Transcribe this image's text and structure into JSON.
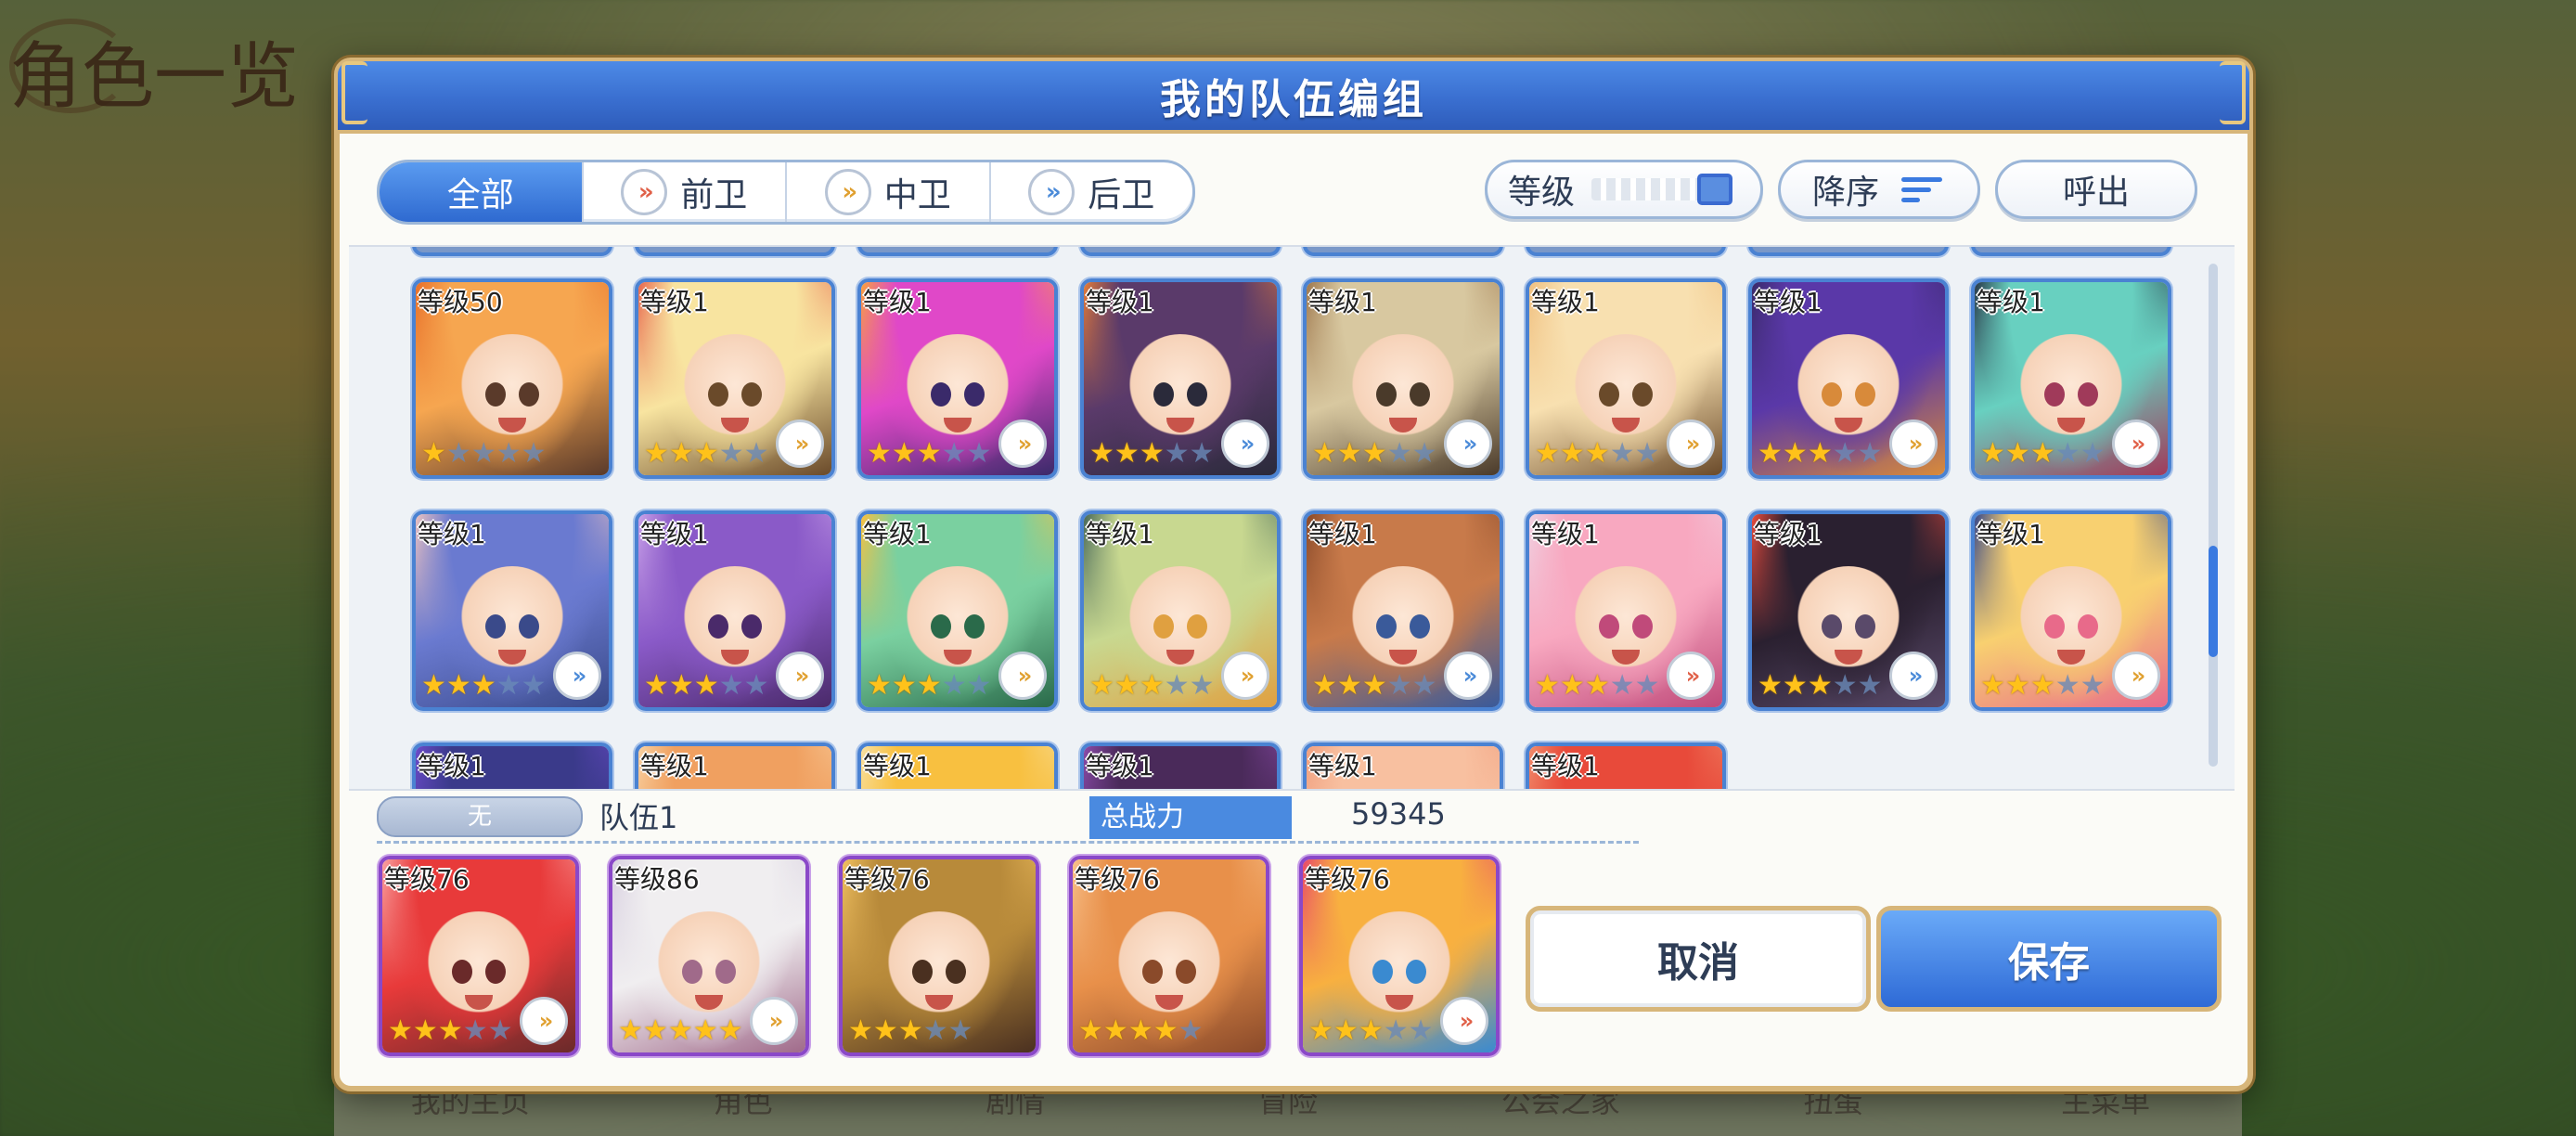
{
  "background": {
    "title": "角色一览",
    "nav": [
      "我的主页",
      "角色",
      "剧情",
      "冒险",
      "公会之家",
      "扭蛋",
      "主菜单"
    ]
  },
  "dialog": {
    "title": "我的队伍编组",
    "tabs": [
      {
        "label": "全部",
        "icon": "",
        "active": true
      },
      {
        "label": "前卫",
        "icon": "front-position-icon",
        "active": false
      },
      {
        "label": "中卫",
        "icon": "mid-position-icon",
        "active": false
      },
      {
        "label": "后卫",
        "icon": "back-position-icon",
        "active": false
      }
    ],
    "sort_label": "等级",
    "order_label": "降序",
    "call_label": "呼出",
    "scroll_position": 0.72
  },
  "characters": [
    {
      "level": "等级50",
      "stars": 1,
      "max": 5,
      "position": "",
      "colors": [
        "#f6a650",
        "#e8702a",
        "#5a3a2a"
      ]
    },
    {
      "level": "等级1",
      "stars": 3,
      "max": 5,
      "position": "mid",
      "colors": [
        "#f8e4a0",
        "#e86a50",
        "#6a4a2a"
      ]
    },
    {
      "level": "等级1",
      "stars": 3,
      "max": 5,
      "position": "mid",
      "colors": [
        "#e048c8",
        "#f8a040",
        "#3a2a6a"
      ]
    },
    {
      "level": "等级1",
      "stars": 3,
      "max": 5,
      "position": "back",
      "colors": [
        "#5a3a6a",
        "#e07a3a",
        "#2a2a3a"
      ]
    },
    {
      "level": "等级1",
      "stars": 3,
      "max": 5,
      "position": "back",
      "colors": [
        "#d8c8a0",
        "#a07a50",
        "#4a3a2a"
      ]
    },
    {
      "level": "等级1",
      "stars": 3,
      "max": 5,
      "position": "mid",
      "colors": [
        "#f8e0b0",
        "#f0c080",
        "#6a4a2a"
      ]
    },
    {
      "level": "等级1",
      "stars": 3,
      "max": 5,
      "position": "mid",
      "colors": [
        "#5a38a8",
        "#3a2a6a",
        "#d88a3a"
      ]
    },
    {
      "level": "等级1",
      "stars": 3,
      "max": 5,
      "position": "front",
      "colors": [
        "#68d0c0",
        "#2a3a4a",
        "#a03a5a"
      ]
    },
    {
      "level": "等级1",
      "stars": 3,
      "max": 5,
      "position": "back",
      "colors": [
        "#6a7ad0",
        "#e8c0c0",
        "#3a4a8a"
      ]
    },
    {
      "level": "等级1",
      "stars": 3,
      "max": 5,
      "position": "mid",
      "colors": [
        "#8a5ac8",
        "#c8a0e8",
        "#4a2a6a"
      ]
    },
    {
      "level": "等级1",
      "stars": 3,
      "max": 5,
      "position": "mid",
      "colors": [
        "#7ad0a0",
        "#f8c040",
        "#2a6a4a"
      ]
    },
    {
      "level": "等级1",
      "stars": 3,
      "max": 5,
      "position": "mid",
      "colors": [
        "#c8d890",
        "#4a6a5a",
        "#e0a040"
      ]
    },
    {
      "level": "等级1",
      "stars": 3,
      "max": 5,
      "position": "back",
      "colors": [
        "#c87a4a",
        "#8a4a2a",
        "#3a5a9a"
      ]
    },
    {
      "level": "等级1",
      "stars": 3,
      "max": 5,
      "position": "front",
      "colors": [
        "#f8a8c0",
        "#f0d0e0",
        "#c04a7a"
      ]
    },
    {
      "level": "等级1",
      "stars": 3,
      "max": 5,
      "position": "back",
      "colors": [
        "#2a2030",
        "#e84a3a",
        "#5a4a6a"
      ]
    },
    {
      "level": "等级1",
      "stars": 3,
      "max": 5,
      "position": "mid",
      "colors": [
        "#f8d070",
        "#3a4a8a",
        "#e86a8a"
      ]
    },
    {
      "level": "等级1",
      "stars": 0,
      "max": 5,
      "position": "",
      "colors": [
        "#3a3a8a",
        "#6a4ac8",
        "#2a2a4a"
      ]
    },
    {
      "level": "等级1",
      "stars": 0,
      "max": 5,
      "position": "",
      "colors": [
        "#f0a060",
        "#f8d0a0",
        "#c86a3a"
      ]
    },
    {
      "level": "等级1",
      "stars": 0,
      "max": 5,
      "position": "",
      "colors": [
        "#f8c040",
        "#f8e0a0",
        "#d88a2a"
      ]
    },
    {
      "level": "等级1",
      "stars": 0,
      "max": 5,
      "position": "",
      "colors": [
        "#4a2a5a",
        "#8a4aa8",
        "#2a1a3a"
      ]
    },
    {
      "level": "等级1",
      "stars": 0,
      "max": 5,
      "position": "",
      "colors": [
        "#f8c0a0",
        "#f0a080",
        "#c85a3a"
      ]
    },
    {
      "level": "等级1",
      "stars": 0,
      "max": 5,
      "position": "",
      "colors": [
        "#e84a3a",
        "#f08a6a",
        "#a02a2a"
      ]
    }
  ],
  "team": {
    "badge": "无",
    "name": "队伍1",
    "power_label": "总战力",
    "power_value": "59345",
    "members": [
      {
        "level": "等级76",
        "stars": 3,
        "max": 5,
        "position": "mid",
        "colors": [
          "#e83a3a",
          "#f8a0a0",
          "#6a2a2a"
        ]
      },
      {
        "level": "等级86",
        "stars": 5,
        "max": 5,
        "position": "mid",
        "colors": [
          "#f0eef0",
          "#d8d0e0",
          "#a06a8a"
        ]
      },
      {
        "level": "等级76",
        "stars": 3,
        "max": 5,
        "position": "",
        "colors": [
          "#b88a3a",
          "#f0c060",
          "#4a3020"
        ]
      },
      {
        "level": "等级76",
        "stars": 4,
        "max": 5,
        "position": "",
        "colors": [
          "#e8904a",
          "#f8c08a",
          "#8a4a2a"
        ]
      },
      {
        "level": "等级76",
        "stars": 3,
        "max": 5,
        "position": "front",
        "colors": [
          "#f8b040",
          "#e84a6a",
          "#3a8ad0"
        ]
      }
    ]
  },
  "buttons": {
    "cancel": "取消",
    "save": "保存"
  }
}
